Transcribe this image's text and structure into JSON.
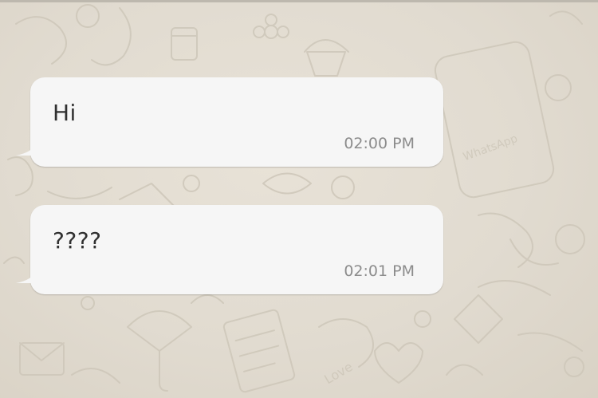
{
  "chat": {
    "messages": [
      {
        "text": "Hi",
        "time": "02:00 PM"
      },
      {
        "text": "????",
        "time": "02:01 PM"
      }
    ]
  },
  "theme": {
    "background": "#e5dfd4",
    "bubble": "#f6f6f6",
    "text": "#303030",
    "timestamp": "#8c8c8c"
  }
}
